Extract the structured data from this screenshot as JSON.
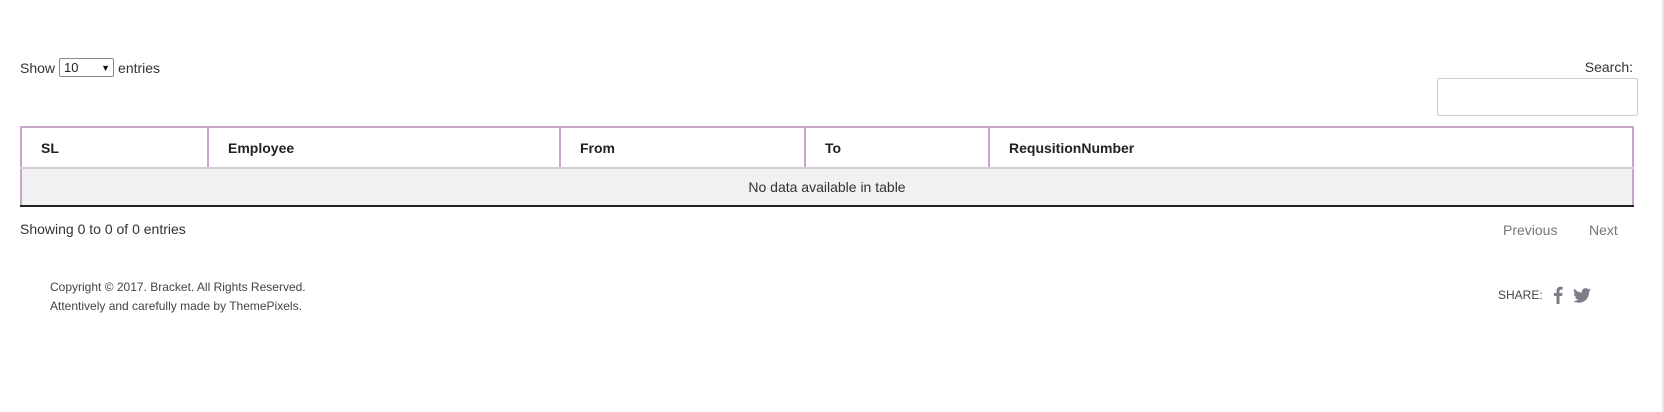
{
  "length_menu": {
    "prefix": "Show",
    "selected": "10",
    "suffix": "entries"
  },
  "search": {
    "label": "Search:",
    "value": ""
  },
  "table": {
    "columns": [
      "SL",
      "Employee",
      "From",
      "To",
      "RequsitionNumber"
    ],
    "empty_message": "No data available in table"
  },
  "info": "Showing 0 to 0 of 0 entries",
  "pagination": {
    "previous": "Previous",
    "next": "Next"
  },
  "footer": {
    "copyright": "Copyright © 2017. Bracket. All Rights Reserved.",
    "credit": "Attentively and carefully made by ThemePixels.",
    "share_label": "SHARE:",
    "share_icons": [
      "facebook-icon",
      "twitter-icon"
    ]
  },
  "colors": {
    "table_border": "#c7a6c9",
    "empty_row_bg": "#f1f1f1",
    "pagination_text": "#777777"
  }
}
